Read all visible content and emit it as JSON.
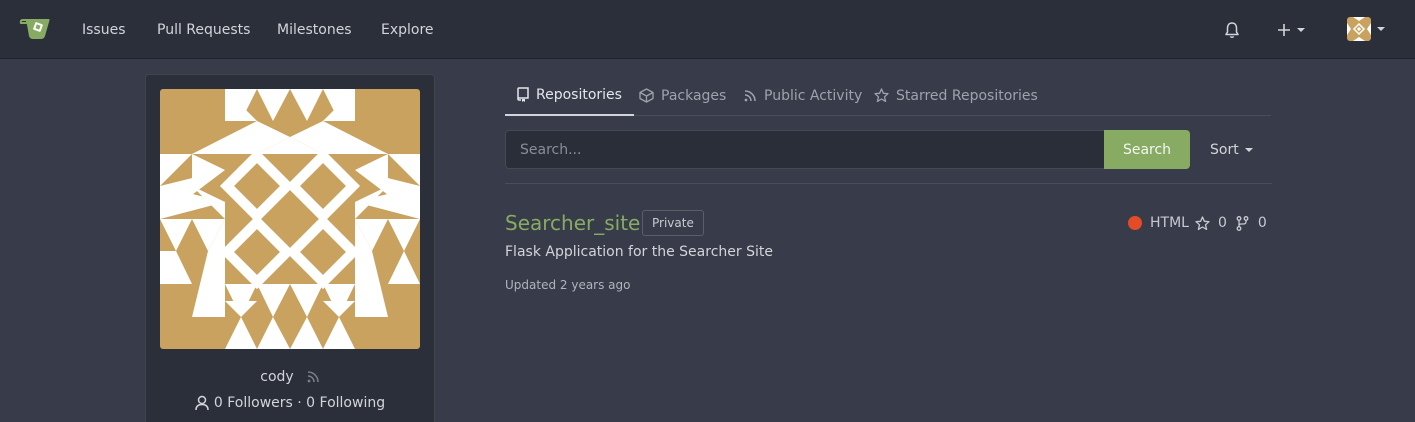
{
  "nav": {
    "items": [
      "Issues",
      "Pull Requests",
      "Milestones",
      "Explore"
    ],
    "icons": [
      "bell-icon",
      "plus-icon",
      "avatar"
    ]
  },
  "profile": {
    "username": "cody",
    "followers_text": "0 Followers · 0 Following"
  },
  "tabs": [
    {
      "label": "Repositories",
      "icon": "repo-icon"
    },
    {
      "label": "Packages",
      "icon": "package-icon"
    },
    {
      "label": "Public Activity",
      "icon": "rss-icon"
    },
    {
      "label": "Starred Repositories",
      "icon": "star-icon"
    }
  ],
  "search": {
    "placeholder": "Search...",
    "button_label": "Search",
    "sort_label": "Sort"
  },
  "repo": {
    "name": "Searcher_site",
    "badge": "Private",
    "language": "HTML",
    "language_color": "#e34c26",
    "stars": "0",
    "forks": "0",
    "description": "Flask Application for the Searcher Site",
    "updated": "Updated 2 years ago"
  },
  "colors": {
    "accent": "#87ab63",
    "avatar_bg": "#c9a25f"
  }
}
